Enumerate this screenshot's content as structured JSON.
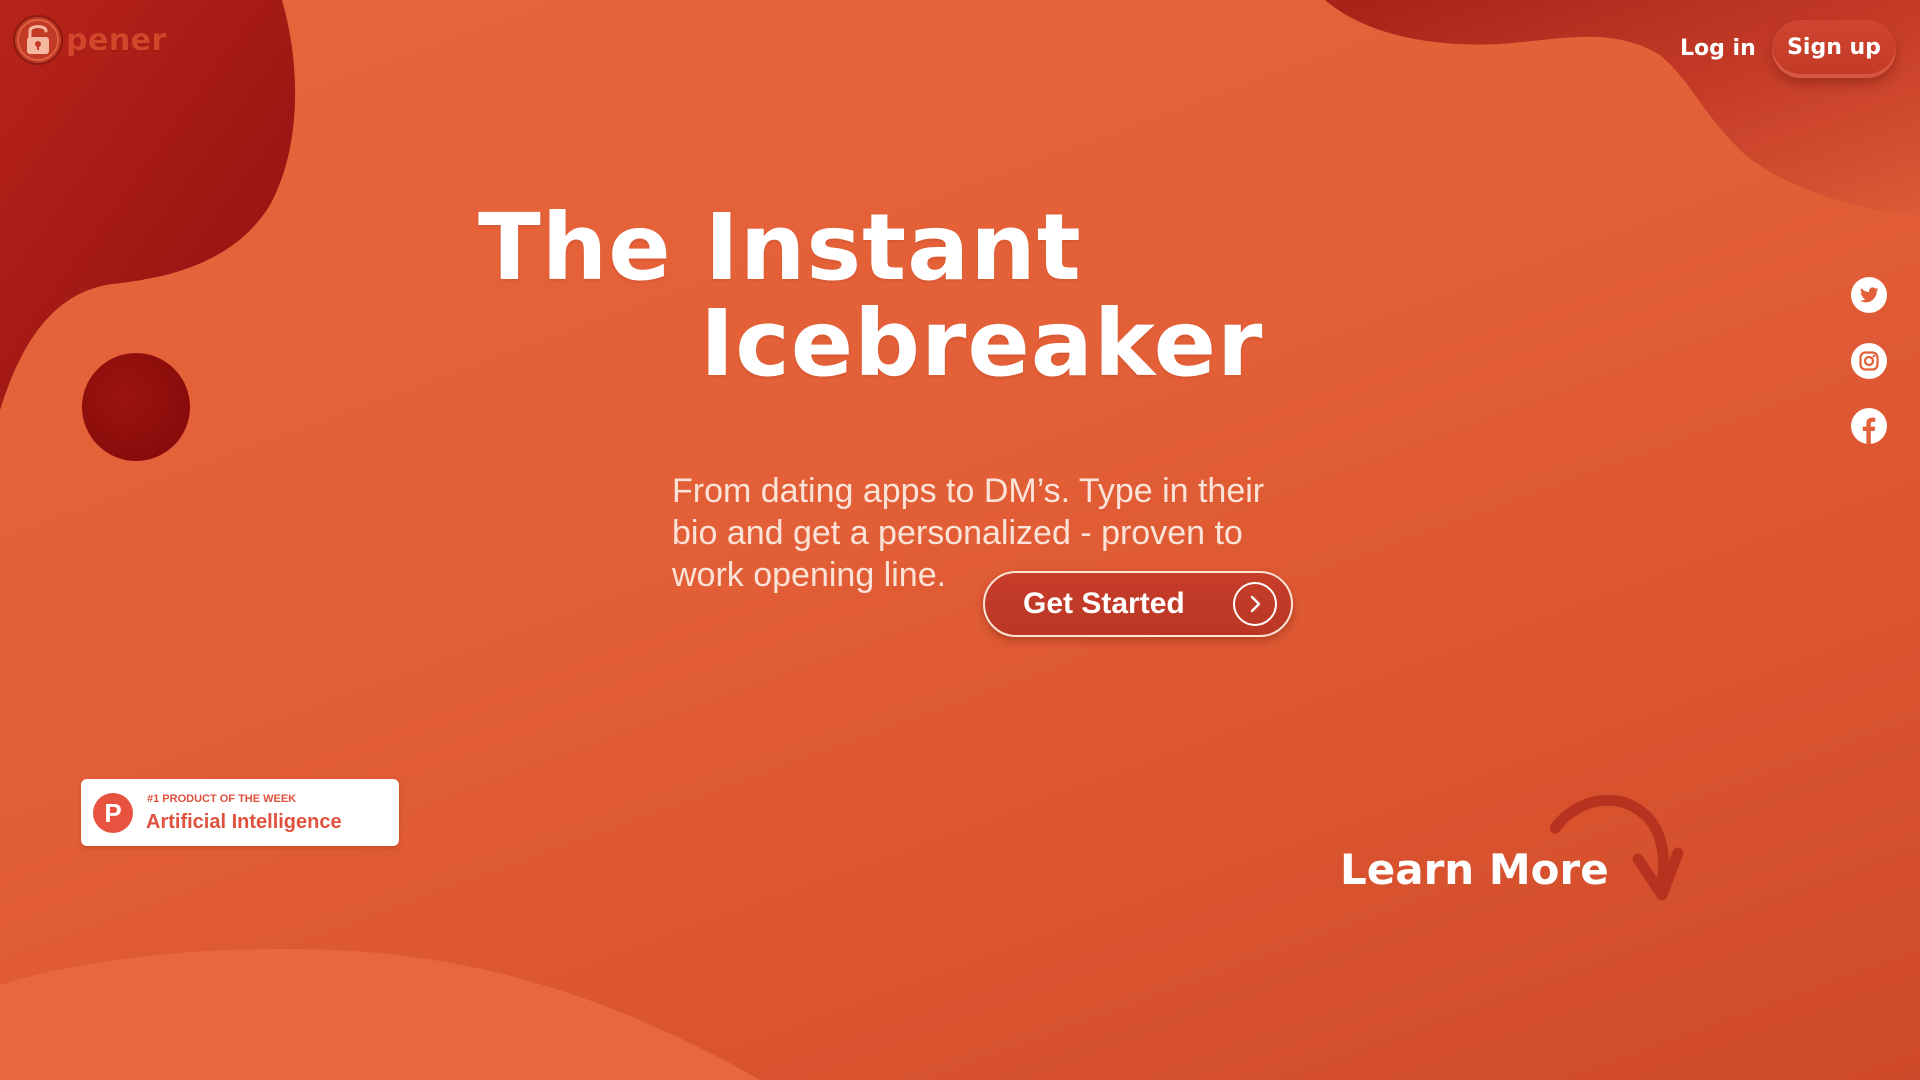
{
  "brand": {
    "logo_text": "pener",
    "logo_icon": "padlock-icon"
  },
  "nav": {
    "login_label": "Log in",
    "signup_label": "Sign up"
  },
  "social": [
    {
      "name": "twitter",
      "icon": "twitter-icon"
    },
    {
      "name": "instagram",
      "icon": "instagram-icon"
    },
    {
      "name": "facebook",
      "icon": "facebook-icon"
    }
  ],
  "hero": {
    "title_line_1": "The Instant",
    "title_line_2": "Icebreaker",
    "subtitle": "From dating apps to DM’s. Type in their bio and get a personalized - proven to work opening line.",
    "cta_label": "Get Started",
    "cta_icon": "chevron-right-icon"
  },
  "badge": {
    "letter": "P",
    "kicker": "#1 PRODUCT OF THE WEEK",
    "title": "Artificial Intelligence"
  },
  "learn_more": {
    "label": "Learn More",
    "icon": "curved-arrow-down-icon"
  },
  "colors": {
    "background": "#e35f37",
    "blob_dark": "#a8201a",
    "button_red": "#c23a27",
    "text_light": "#fbe3d8",
    "badge_red": "#e0523e"
  }
}
